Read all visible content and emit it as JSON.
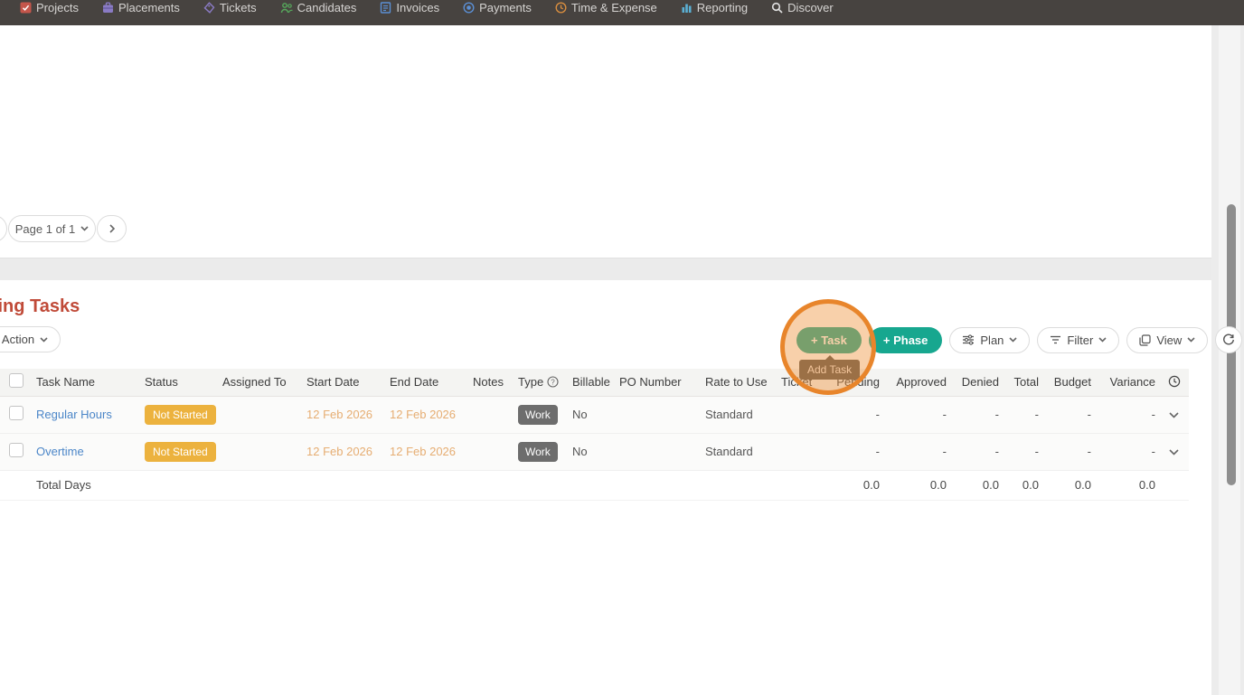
{
  "nav": {
    "items": [
      {
        "label": "Projects",
        "icon": "projects-checkbox-icon"
      },
      {
        "label": "Placements",
        "icon": "briefcase-icon"
      },
      {
        "label": "Tickets",
        "icon": "ticket-icon"
      },
      {
        "label": "Candidates",
        "icon": "people-icon"
      },
      {
        "label": "Invoices",
        "icon": "document-icon"
      },
      {
        "label": "Payments",
        "icon": "coin-icon"
      },
      {
        "label": "Time & Expense",
        "icon": "clock-icon"
      },
      {
        "label": "Reporting",
        "icon": "bar-chart-icon"
      },
      {
        "label": "Discover",
        "icon": "search-icon"
      }
    ]
  },
  "pagination": {
    "page_label": "Page 1 of 1",
    "next_label": "›"
  },
  "section": {
    "title": "Planning Tasks",
    "action_label": "Action",
    "task_button": "+ Task",
    "phase_button": "+ Phase",
    "plan_button": "Plan",
    "filter_button": "Filter",
    "view_button": "View",
    "tooltip": "Add Task"
  },
  "table": {
    "headers": [
      "Task Name",
      "Status",
      "Assigned To",
      "Start Date",
      "End Date",
      "Notes",
      "Type",
      "Billable",
      "PO Number",
      "Rate to Use",
      "Ticket",
      "Pending",
      "Approved",
      "Denied",
      "Total",
      "Budget",
      "Variance"
    ],
    "rows": [
      {
        "task_name": "Regular Hours",
        "status": "Not Started",
        "assigned_to": "",
        "start_date": "12 Feb 2026",
        "end_date": "12 Feb 2026",
        "notes": "",
        "type": "Work",
        "billable": "No",
        "po_number": "",
        "rate_to_use": "Standard",
        "ticket": "",
        "pending": "-",
        "approved": "-",
        "denied": "-",
        "total": "-",
        "budget": "-",
        "variance": "-"
      },
      {
        "task_name": "Overtime",
        "status": "Not Started",
        "assigned_to": "",
        "start_date": "12 Feb 2026",
        "end_date": "12 Feb 2026",
        "notes": "",
        "type": "Work",
        "billable": "No",
        "po_number": "",
        "rate_to_use": "Standard",
        "ticket": "",
        "pending": "-",
        "approved": "-",
        "denied": "-",
        "total": "-",
        "budget": "-",
        "variance": "-"
      }
    ],
    "totals": {
      "label": "Total Days",
      "pending": "0.0",
      "approved": "0.0",
      "denied": "0.0",
      "total": "0.0",
      "budget": "0.0",
      "variance": "0.0"
    }
  },
  "colors": {
    "nav_bg": "#474340",
    "heading_red": "#c04a38",
    "accent_teal": "#17a78f",
    "link_blue": "#4b86c8",
    "badge_amber": "#ecb23e",
    "badge_gray": "#6d6d6d",
    "date_orange": "#e6ad72",
    "annotation_orange": "#e8852b"
  }
}
